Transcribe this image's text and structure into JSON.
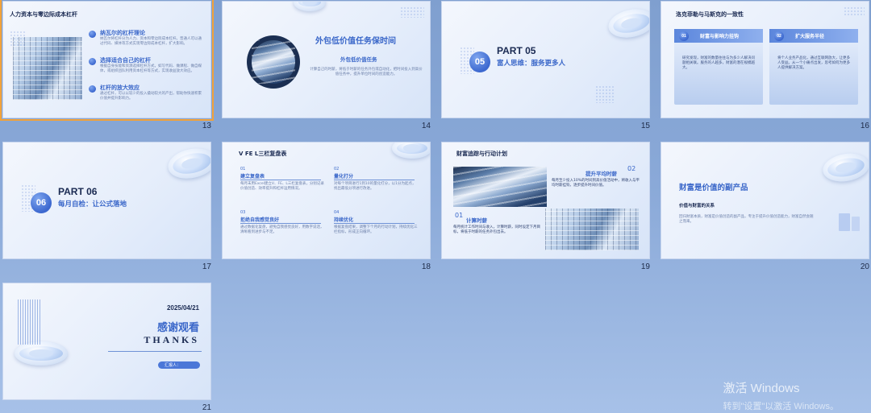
{
  "slides": {
    "s13": {
      "number": "13",
      "title": "人力资本与零边际成本杠杆",
      "items": [
        {
          "heading": "纳瓦尔的杠杆理论",
          "text": "纳瓦尔将杠杆分为人力、资本和零边际成本杠杆。普通人可以通过代码、媒体等方式实现零边际成本杠杆，扩大影响。"
        },
        {
          "heading": "选择适合自己的杠杆",
          "text": "根据自身技能和资源选择杠杆方式，如写代码、做课程、做自媒体，或组织团队利用资本杠杆等方式，实现收益放大效应。"
        },
        {
          "heading": "杠杆的放大效应",
          "text": "通过杠杆，可以以较少的投入撬动较大的产出，帮助你快速积累价值并提升影响力。"
        }
      ]
    },
    "s14": {
      "number": "14",
      "title": "外包低价值任务保时间",
      "subtitle": "外包低价值任务",
      "text": "计算自己的时薪，将低于时薪的任务外包或自动化，把时间投入到高价值任务中，提升单位时间的创造能力。"
    },
    "s15": {
      "number": "15",
      "badge": "05",
      "part": "PART 05",
      "subtitle": "富人思维：服务更多人"
    },
    "s16": {
      "number": "16",
      "title": "洛克菲勒与马斯克的一致性",
      "cards": [
        {
          "num": "01",
          "heading": "财富与影响力挂钩",
          "text": "研究发现，财富的数量往往与为多少人解决问题相关联。服务的人越多，财富的潜在规模越大。"
        },
        {
          "num": "02",
          "heading": "扩大服务半径",
          "text": "将个人业务产品化，通过互联网放大，让更多人受益。从一个小痛点出发，思考如何为更多人提供解决方案。"
        }
      ]
    },
    "s17": {
      "number": "17",
      "badge": "06",
      "part": "PART 06",
      "subtitle": "每月自检：让公式落地"
    },
    "s18": {
      "number": "18",
      "title": "V FE L三栏复盘表",
      "items": [
        {
          "num": "01",
          "heading": "建立复盘表",
          "text": "每月末用Excel建立V、FE、L三栏复盘表，分别记录价值创造、效率提升和杠杆运用情况。"
        },
        {
          "num": "02",
          "heading": "量化打分",
          "text": "对每个项目进行1到10的量化打分，以1分为起点，找出最低分项进行改进。"
        },
        {
          "num": "03",
          "heading": "拒绝自我感觉良好",
          "text": "通过数据化复盘，避免自我感觉良好，用数字说话，清晰看到进步与不足。"
        },
        {
          "num": "04",
          "heading": "持续优化",
          "text": "根据复盘结果，调整下个月的行动计划，持续优化三栏指标，形成正向循环。"
        }
      ]
    },
    "s19": {
      "number": "19",
      "title": "财富追踪与行动计划",
      "items": [
        {
          "num": "02",
          "heading": "提升平均时薪",
          "text": "每月至少投入10%的时间到高价值活动中，将收入与平均时薪挂钩，逐步提升时间价值。"
        },
        {
          "num": "01",
          "heading": "计算时薪",
          "text": "每月统计工作时间与收入，计算时薪，同时设定下月目标，将低于时薪的任务外包出去。"
        }
      ]
    },
    "s20": {
      "number": "20",
      "title": "财富是价值的副产品",
      "subheading": "价值与财富的关系",
      "text": "回归财富本质，财富是价值创造的副产品，专注于提升价值创造能力，财富自然会随之而来。"
    },
    "s21": {
      "number": "21",
      "date": "2025/04/21",
      "thanks_cn": "感谢观看",
      "thanks_en": "THANKS",
      "reporter": "汇报人："
    }
  },
  "watermark": {
    "line1": "激活 Windows",
    "line2": "转到\"设置\"以激活 Windows。"
  },
  "colors": {
    "accent": "#3a67c9",
    "selection": "#f2a23a",
    "background": "#8aa9d8"
  }
}
